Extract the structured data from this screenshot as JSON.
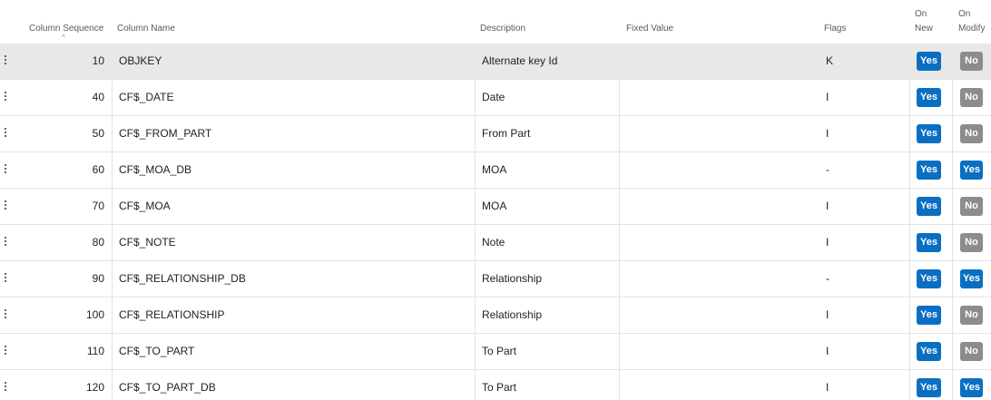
{
  "headers": {
    "column_sequence": "Column Sequence",
    "column_name": "Column Name",
    "description": "Description",
    "fixed_value": "Fixed Value",
    "flags": "Flags",
    "on_new_line1": "On",
    "on_new_line2": "New",
    "on_modify_line1": "On",
    "on_modify_line2": "Modify",
    "sort_indicator": "^"
  },
  "icons": {
    "row_menu": "kebab-vertical-dots-icon",
    "sort": "sort-ascending-icon"
  },
  "colors": {
    "yes": "#0a6fc2",
    "no": "#8c8c8c",
    "selected_row": "#e8e8e8"
  },
  "rows": [
    {
      "seq": "10",
      "name": "OBJKEY",
      "description": "Alternate key Id",
      "fixed": "",
      "flags": "K",
      "on_new": "Yes",
      "on_modify": "No",
      "selected": true
    },
    {
      "seq": "40",
      "name": "CF$_DATE",
      "description": "Date",
      "fixed": "",
      "flags": "I",
      "on_new": "Yes",
      "on_modify": "No",
      "selected": false
    },
    {
      "seq": "50",
      "name": "CF$_FROM_PART",
      "description": "From Part",
      "fixed": "",
      "flags": "I",
      "on_new": "Yes",
      "on_modify": "No",
      "selected": false
    },
    {
      "seq": "60",
      "name": "CF$_MOA_DB",
      "description": "MOA",
      "fixed": "",
      "flags": "-",
      "on_new": "Yes",
      "on_modify": "Yes",
      "selected": false
    },
    {
      "seq": "70",
      "name": "CF$_MOA",
      "description": "MOA",
      "fixed": "",
      "flags": "I",
      "on_new": "Yes",
      "on_modify": "No",
      "selected": false
    },
    {
      "seq": "80",
      "name": "CF$_NOTE",
      "description": "Note",
      "fixed": "",
      "flags": "I",
      "on_new": "Yes",
      "on_modify": "No",
      "selected": false
    },
    {
      "seq": "90",
      "name": "CF$_RELATIONSHIP_DB",
      "description": "Relationship",
      "fixed": "",
      "flags": "-",
      "on_new": "Yes",
      "on_modify": "Yes",
      "selected": false
    },
    {
      "seq": "100",
      "name": "CF$_RELATIONSHIP",
      "description": "Relationship",
      "fixed": "",
      "flags": "I",
      "on_new": "Yes",
      "on_modify": "No",
      "selected": false
    },
    {
      "seq": "110",
      "name": "CF$_TO_PART",
      "description": "To Part",
      "fixed": "",
      "flags": "I",
      "on_new": "Yes",
      "on_modify": "No",
      "selected": false
    },
    {
      "seq": "120",
      "name": "CF$_TO_PART_DB",
      "description": "To Part",
      "fixed": "",
      "flags": "I",
      "on_new": "Yes",
      "on_modify": "Yes",
      "selected": false
    }
  ]
}
